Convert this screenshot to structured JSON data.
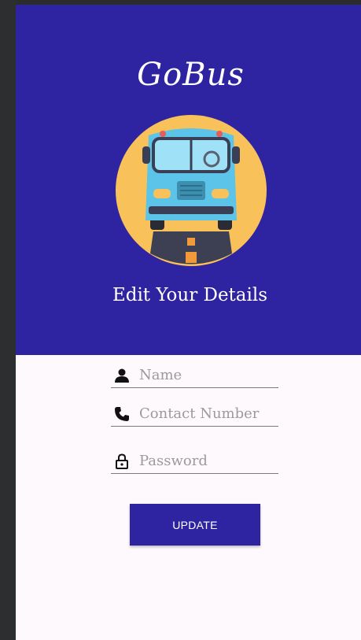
{
  "app": {
    "title": "GoBus",
    "subtitle": "Edit Your Details",
    "logo_icon": "bus-on-road-icon"
  },
  "form": {
    "name": {
      "placeholder": "Name",
      "value": "",
      "icon": "person-icon"
    },
    "contact": {
      "placeholder": "Contact Number",
      "value": "",
      "icon": "phone-icon"
    },
    "password": {
      "placeholder": "Password",
      "value": "",
      "icon": "lock-icon"
    },
    "update_label": "UPDATE"
  },
  "colors": {
    "primary": "#2e24a1",
    "background": "#fdf9fd",
    "logo_circle": "#f9c15a",
    "bus_body": "#5bc4e8"
  }
}
